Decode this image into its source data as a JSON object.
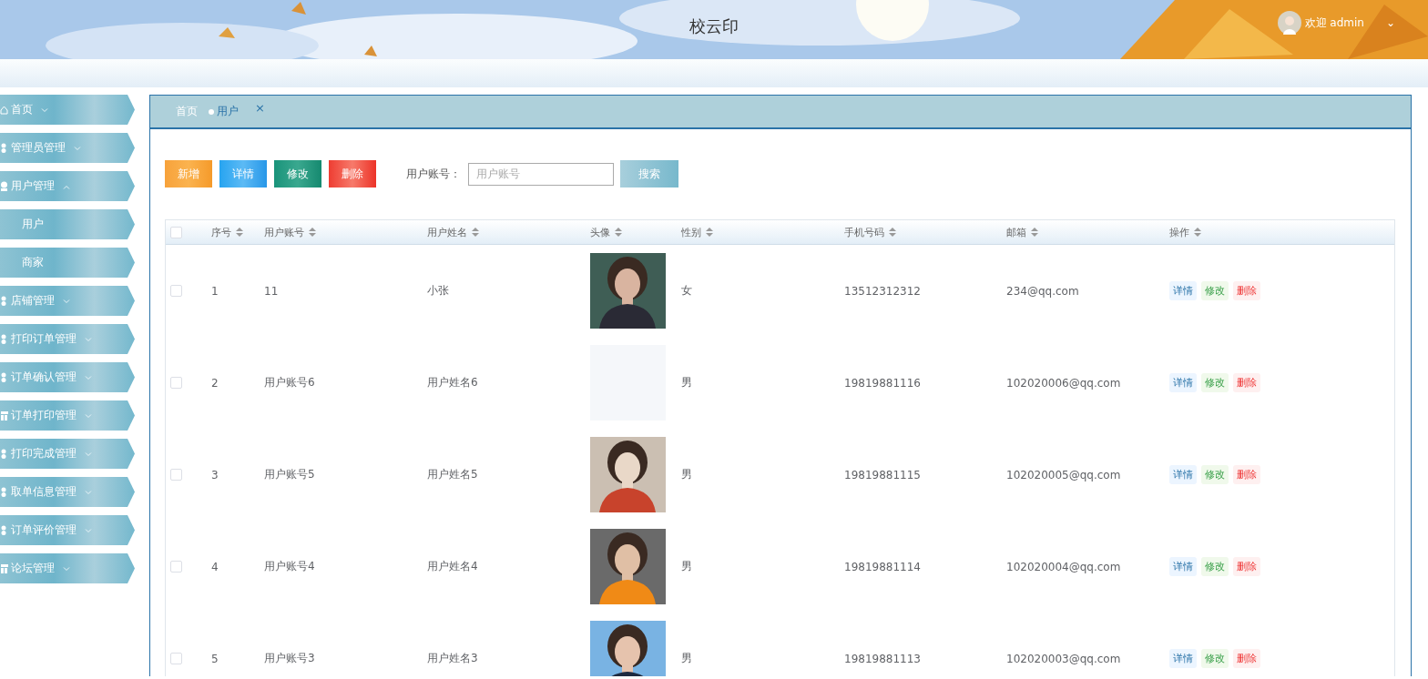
{
  "header": {
    "title": "校云印",
    "user": {
      "greeting": "欢迎 admin",
      "caret": "⌄"
    }
  },
  "sidebar": {
    "items": [
      {
        "kind": "group",
        "label": "首页",
        "expanded": false
      },
      {
        "kind": "group",
        "label": "管理员管理",
        "expanded": false
      },
      {
        "kind": "group",
        "label": "用户管理",
        "expanded": true
      },
      {
        "kind": "child",
        "label": "用户"
      },
      {
        "kind": "child",
        "label": "商家"
      },
      {
        "kind": "group",
        "label": "店铺管理",
        "expanded": false
      },
      {
        "kind": "group",
        "label": "打印订单管理",
        "expanded": false
      },
      {
        "kind": "group",
        "label": "订单确认管理",
        "expanded": false
      },
      {
        "kind": "group",
        "label": "订单打印管理",
        "expanded": false
      },
      {
        "kind": "group",
        "label": "打印完成管理",
        "expanded": false
      },
      {
        "kind": "group",
        "label": "取单信息管理",
        "expanded": false
      },
      {
        "kind": "group",
        "label": "订单评价管理",
        "expanded": false
      },
      {
        "kind": "group",
        "label": "论坛管理",
        "expanded": false
      }
    ]
  },
  "tabs": [
    {
      "label": "首页",
      "selected": false
    },
    {
      "label": "用户",
      "selected": true,
      "close": "×"
    }
  ],
  "toolbar": {
    "buttons": [
      {
        "kind": "add",
        "label": "新增"
      },
      {
        "kind": "detail",
        "label": "详情"
      },
      {
        "kind": "edit",
        "label": "修改"
      },
      {
        "kind": "delete",
        "label": "删除"
      }
    ],
    "search_label": "用户账号：",
    "search": {
      "placeholder": "用户账号"
    },
    "search_button": "搜索"
  },
  "table": {
    "select_all_checked": false,
    "columns": [
      "序号",
      "用户账号",
      "用户姓名",
      "头像",
      "性别",
      "手机号码",
      "邮箱",
      "操作"
    ],
    "rows": [
      {
        "checked": false,
        "cells": [
          "1",
          "11",
          "小张"
        ],
        "avatar": {
          "kind": "picture"
        },
        "rest": [
          "女",
          "13512312312",
          "234@qq.com"
        ],
        "actions": [
          {
            "kind": "detail",
            "label": "详情"
          },
          {
            "kind": "edit",
            "label": "修改"
          },
          {
            "kind": "delete",
            "label": "删除"
          }
        ]
      },
      {
        "checked": false,
        "cells": [
          "2",
          "用户账号6",
          "用户姓名6"
        ],
        "avatar": {
          "kind": "empty"
        },
        "rest": [
          "男",
          "19819881116",
          "102020006@qq.com"
        ],
        "actions": [
          {
            "kind": "detail",
            "label": "详情"
          },
          {
            "kind": "edit",
            "label": "修改"
          },
          {
            "kind": "delete",
            "label": "删除"
          }
        ]
      },
      {
        "checked": false,
        "cells": [
          "3",
          "用户账号5",
          "用户姓名5"
        ],
        "avatar": {
          "kind": "picture"
        },
        "rest": [
          "男",
          "19819881115",
          "102020005@qq.com"
        ],
        "actions": [
          {
            "kind": "detail",
            "label": "详情"
          },
          {
            "kind": "edit",
            "label": "修改"
          },
          {
            "kind": "delete",
            "label": "删除"
          }
        ]
      },
      {
        "checked": false,
        "cells": [
          "4",
          "用户账号4",
          "用户姓名4"
        ],
        "avatar": {
          "kind": "picture"
        },
        "rest": [
          "男",
          "19819881114",
          "102020004@qq.com"
        ],
        "actions": [
          {
            "kind": "detail",
            "label": "详情"
          },
          {
            "kind": "edit",
            "label": "修改"
          },
          {
            "kind": "delete",
            "label": "删除"
          }
        ]
      },
      {
        "checked": false,
        "cells": [
          "5",
          "用户账号3",
          "用户姓名3"
        ],
        "avatar": {
          "kind": "picture"
        },
        "rest": [
          "男",
          "19819881113",
          "102020003@qq.com"
        ],
        "actions": [
          {
            "kind": "detail",
            "label": "详情"
          },
          {
            "kind": "edit",
            "label": "修改"
          },
          {
            "kind": "delete",
            "label": "删除"
          }
        ]
      }
    ]
  }
}
